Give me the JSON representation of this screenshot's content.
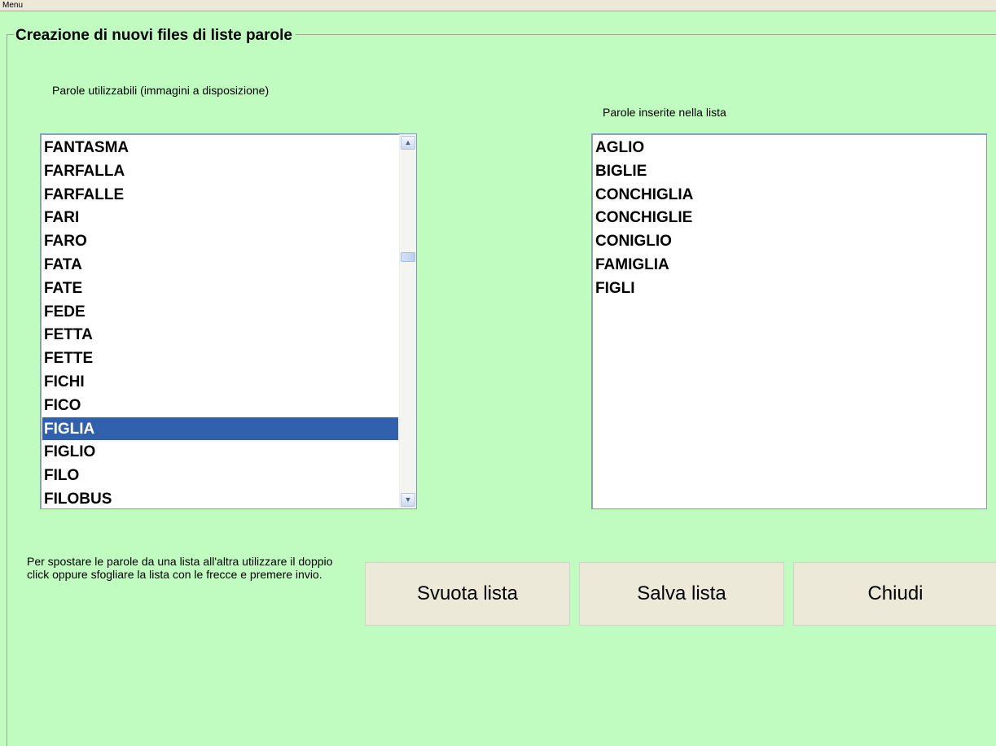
{
  "menubar": {
    "menu_label": "Menu"
  },
  "groupbox": {
    "title": "Creazione di nuovi files di liste parole"
  },
  "available_list": {
    "label": "Parole utilizzabili (immagini a disposizione)",
    "items": [
      "FANTASMA",
      "FARFALLA",
      "FARFALLE",
      "FARI",
      "FARO",
      "FATA",
      "FATE",
      "FEDE",
      "FETTA",
      "FETTE",
      "FICHI",
      "FICO",
      "FIGLIA",
      "FIGLIO",
      "FILO",
      "FILOBUS"
    ],
    "selected": "FIGLIA"
  },
  "inserted_list": {
    "label": "Parole inserite nella lista",
    "items": [
      "AGLIO",
      "BIGLIE",
      "CONCHIGLIA",
      "CONCHIGLIE",
      "CONIGLIO",
      "FAMIGLIA",
      "FIGLI"
    ]
  },
  "instructions": {
    "text": "Per spostare le parole da una lista all'altra utilizzare il doppio click oppure sfogliare la lista con le frecce e premere invio."
  },
  "buttons": {
    "clear_label": "Svuota lista",
    "save_label": "Salva lista",
    "close_label": "Chiudi"
  },
  "colors": {
    "background": "#c0fcc0",
    "selection": "#3160ad",
    "button_face": "#ece9d8",
    "clipped_title_text": "#1d2db8"
  },
  "icons": {
    "scroll_up": "chevron-up-icon",
    "scroll_down": "chevron-down-icon"
  }
}
